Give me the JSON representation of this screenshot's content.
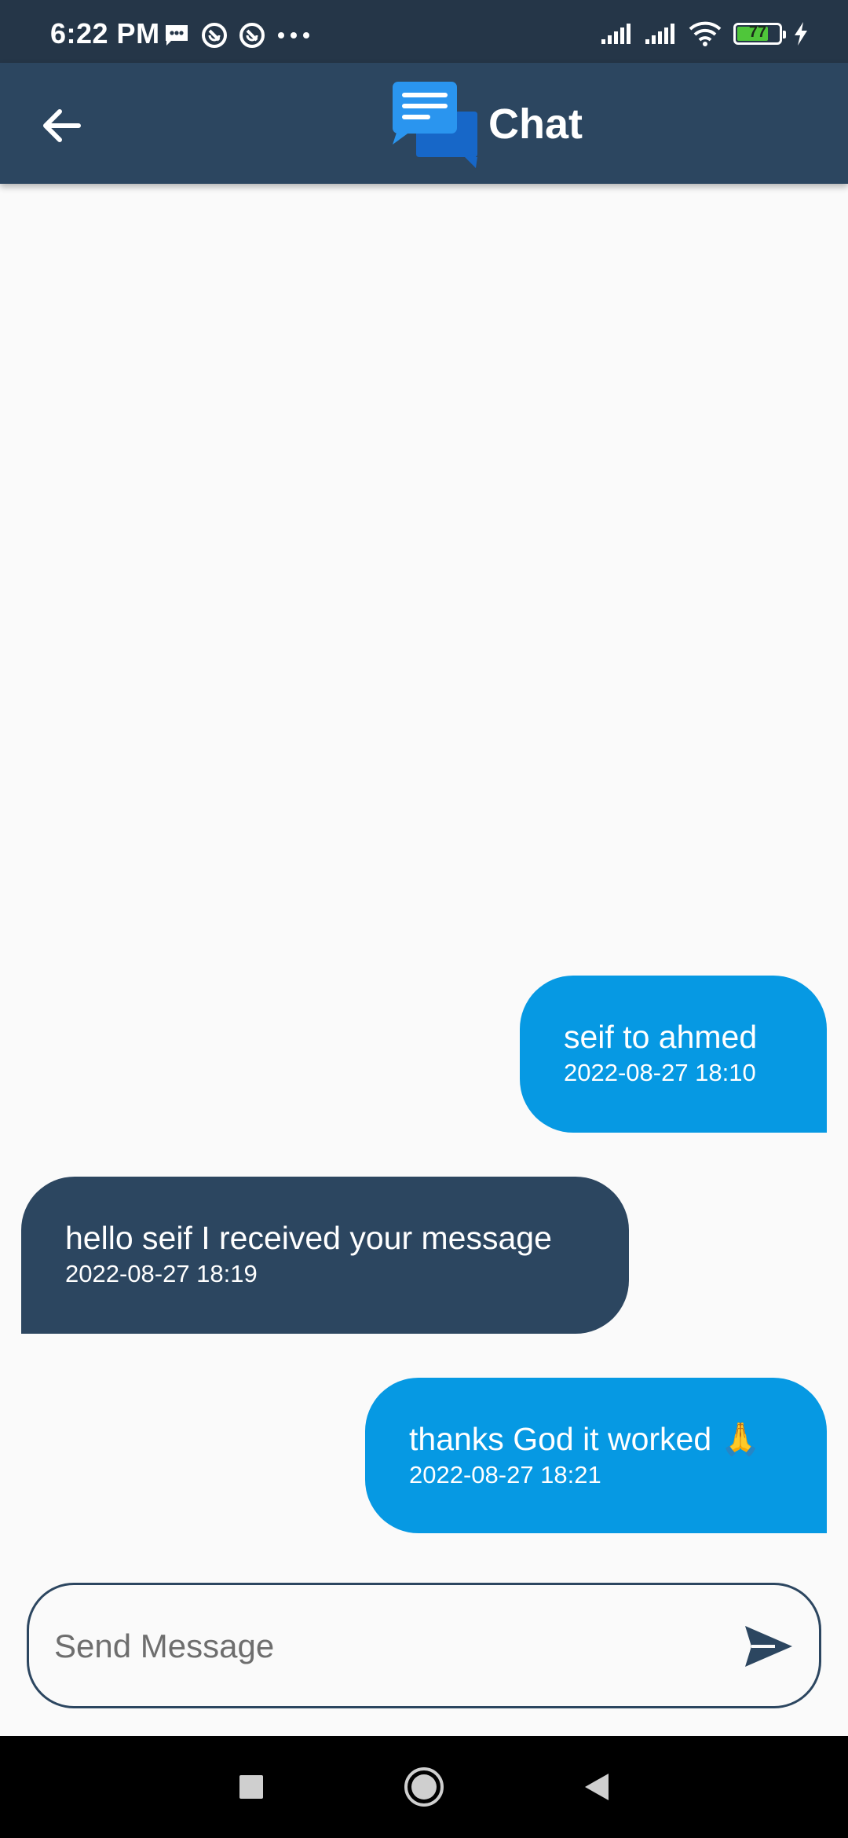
{
  "status_bar": {
    "time": "6:22 PM",
    "left_icons": [
      "message-icon",
      "at-icon",
      "at-icon",
      "more-dots-icon"
    ],
    "right_icons": [
      "signal-icon",
      "signal-icon",
      "wifi-icon",
      "battery-icon",
      "charging-bolt-icon"
    ],
    "battery_level": "77",
    "battery_fraction": 0.77
  },
  "app_bar": {
    "title": "Chat",
    "back_icon": "arrow-left-icon",
    "logo_icon": "chat-bubbles-icon"
  },
  "messages": [
    {
      "direction": "sent",
      "text": "seif to ahmed",
      "time": "2022-08-27 18:10"
    },
    {
      "direction": "received",
      "text": "hello seif I received your message",
      "time": "2022-08-27 18:19"
    },
    {
      "direction": "sent",
      "text": "thanks God it worked 🙏",
      "time": "2022-08-27 18:21"
    }
  ],
  "composer": {
    "placeholder": "Send Message",
    "value": "",
    "send_icon": "send-icon"
  },
  "nav_bar": {
    "icons": [
      "recents-square-icon",
      "home-circle-icon",
      "back-triangle-icon"
    ]
  },
  "colors": {
    "status_bar": "#253648",
    "app_bar": "#2c4660",
    "sent_bubble": "#0699e3",
    "received_bubble": "#2c4660",
    "background": "#fafafa"
  }
}
